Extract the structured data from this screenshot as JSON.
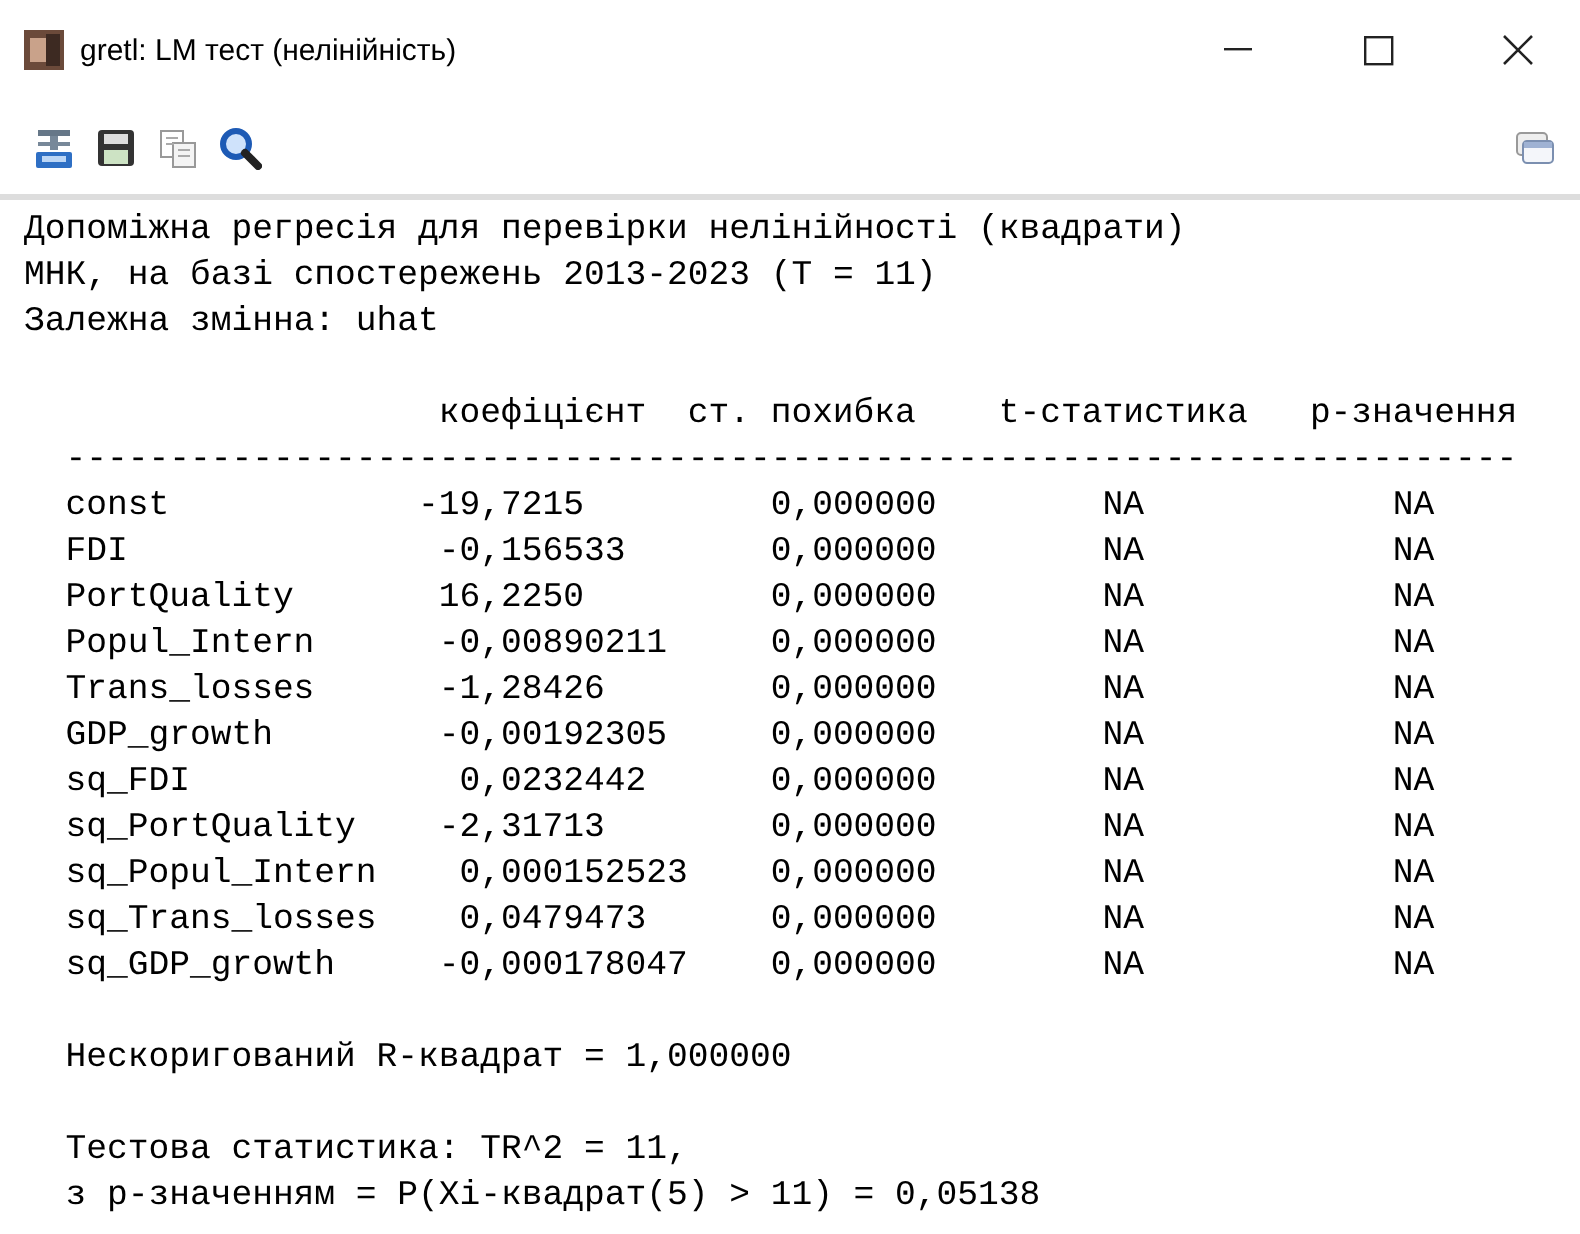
{
  "window": {
    "title": "gretl: LM тест (нелінійність)"
  },
  "output": {
    "intro": [
      "Допоміжна регресія для перевірки нелінійності (квадрати)",
      "МНК, на базі спостережень 2013-2023 (T = 11)",
      "Залежна змінна: uhat"
    ],
    "table": {
      "columns": [
        "коефіцієнт",
        "ст. похибка",
        "t-статистика",
        "p-значення"
      ],
      "rule": "----------------------------------------------------------------------",
      "rows": [
        {
          "name": "const",
          "coef": "-19,7215",
          "se": "0,000000",
          "t": "NA",
          "p": "NA"
        },
        {
          "name": "FDI",
          "coef": "-0,156533",
          "se": "0,000000",
          "t": "NA",
          "p": "NA"
        },
        {
          "name": "PortQuality",
          "coef": "16,2250",
          "se": "0,000000",
          "t": "NA",
          "p": "NA"
        },
        {
          "name": "Popul_Intern",
          "coef": "-0,00890211",
          "se": "0,000000",
          "t": "NA",
          "p": "NA"
        },
        {
          "name": "Trans_losses",
          "coef": "-1,28426",
          "se": "0,000000",
          "t": "NA",
          "p": "NA"
        },
        {
          "name": "GDP_growth",
          "coef": "-0,00192305",
          "se": "0,000000",
          "t": "NA",
          "p": "NA"
        },
        {
          "name": "sq_FDI",
          "coef": "0,0232442",
          "se": "0,000000",
          "t": "NA",
          "p": "NA"
        },
        {
          "name": "sq_PortQuality",
          "coef": "-2,31713",
          "se": "0,000000",
          "t": "NA",
          "p": "NA"
        },
        {
          "name": "sq_Popul_Intern",
          "coef": "0,000152523",
          "se": "0,000000",
          "t": "NA",
          "p": "NA"
        },
        {
          "name": "sq_Trans_losses",
          "coef": "0,0479473",
          "se": "0,000000",
          "t": "NA",
          "p": "NA"
        },
        {
          "name": "sq_GDP_growth",
          "coef": "-0,000178047",
          "se": "0,000000",
          "t": "NA",
          "p": "NA"
        }
      ]
    },
    "r_squared": "Нескоригований R-квадрат = 1,000000",
    "test": [
      "Тестова статистика: TR^2 = 11,",
      "з p-значенням = P(Xi-квадрат(5) > 11) = 0,05138"
    ]
  }
}
